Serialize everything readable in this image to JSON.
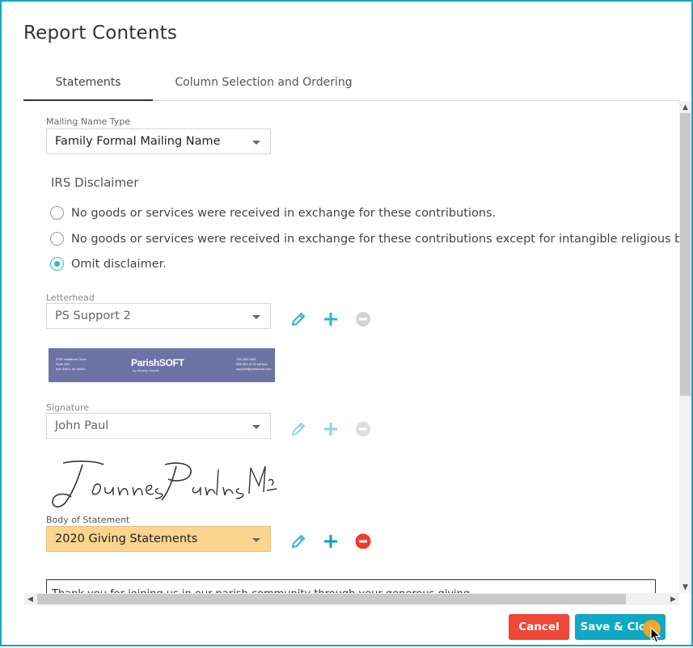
{
  "dialog": {
    "title": "Report Contents",
    "tabs": [
      {
        "label": "Statements",
        "active": true
      },
      {
        "label": "Column Selection and Ordering",
        "active": false
      }
    ]
  },
  "mailing": {
    "label": "Mailing Name Type",
    "value": "Family Formal Mailing Name"
  },
  "irs": {
    "title": "IRS Disclaimer",
    "options": [
      {
        "label": "No goods or services were received in exchange for these contributions.",
        "checked": false
      },
      {
        "label": "No goods or services were received in exchange for these contributions except for intangible religious benefits.",
        "checked": false
      },
      {
        "label": "Omit disclaimer.",
        "checked": true
      }
    ]
  },
  "letterhead": {
    "label": "Letterhead",
    "value": "PS Support 2",
    "image": {
      "address": "2787 Hawthorn Drive\nSuite 100\nAnn Arbor, MI 48000",
      "logo": "ParishSOFT",
      "tagline": "by Ministry Brands",
      "contact": "734.205.1990\n866.929.4778 toll free\nsupport@parishsoft.com"
    }
  },
  "signature": {
    "label": "Signature",
    "value": "John Paul",
    "image_text": "Joannes Paulus PP."
  },
  "body_statement": {
    "label": "Body of Statement",
    "value": "2020 Giving Statements",
    "preview_text": "Thank you for joining us in our parish community through your generous giving..."
  },
  "icons": {
    "edit": "pencil-icon",
    "add": "plus-icon",
    "remove": "minus-circle-icon"
  },
  "colors": {
    "accent": "#13a7c4",
    "icon_teal": "#2bb5cf",
    "danger": "#ef4836",
    "highlight": "#fbd48e",
    "letterhead_bg": "#6e73a6"
  },
  "footer": {
    "cancel_label": "Cancel",
    "save_label": "Save & Close"
  }
}
